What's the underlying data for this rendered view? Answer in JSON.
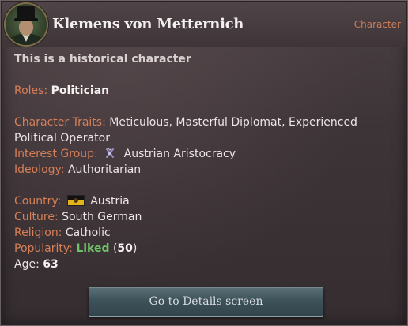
{
  "header": {
    "name": "Klemens von Metternich",
    "kind": "Character",
    "portrait_icon": "character-portrait"
  },
  "note": "This is a historical character",
  "roles": {
    "label": "Roles:",
    "value": "Politician"
  },
  "traits": {
    "label": "Character Traits:",
    "value": "Meticulous, Masterful Diplomat, Experienced Political Operator"
  },
  "interest_group": {
    "label": "Interest Group:",
    "icon": "aristocracy-icon",
    "value": "Austrian Aristocracy"
  },
  "ideology": {
    "label": "Ideology:",
    "value": "Authoritarian"
  },
  "country": {
    "label": "Country:",
    "flag_icon": "austria-flag",
    "value": "Austria"
  },
  "culture": {
    "label": "Culture:",
    "value": "South German"
  },
  "religion": {
    "label": "Religion:",
    "value": "Catholic"
  },
  "popularity": {
    "label": "Popularity:",
    "status": "Liked",
    "open_paren": "(",
    "value": "50",
    "close_paren": ")"
  },
  "age": {
    "label": "Age:",
    "value": "63"
  },
  "button": {
    "label": "Go to Details screen"
  },
  "colors": {
    "label_orange": "#d77f57",
    "liked_green": "#6fc267",
    "kind_orange": "#c97d55"
  }
}
